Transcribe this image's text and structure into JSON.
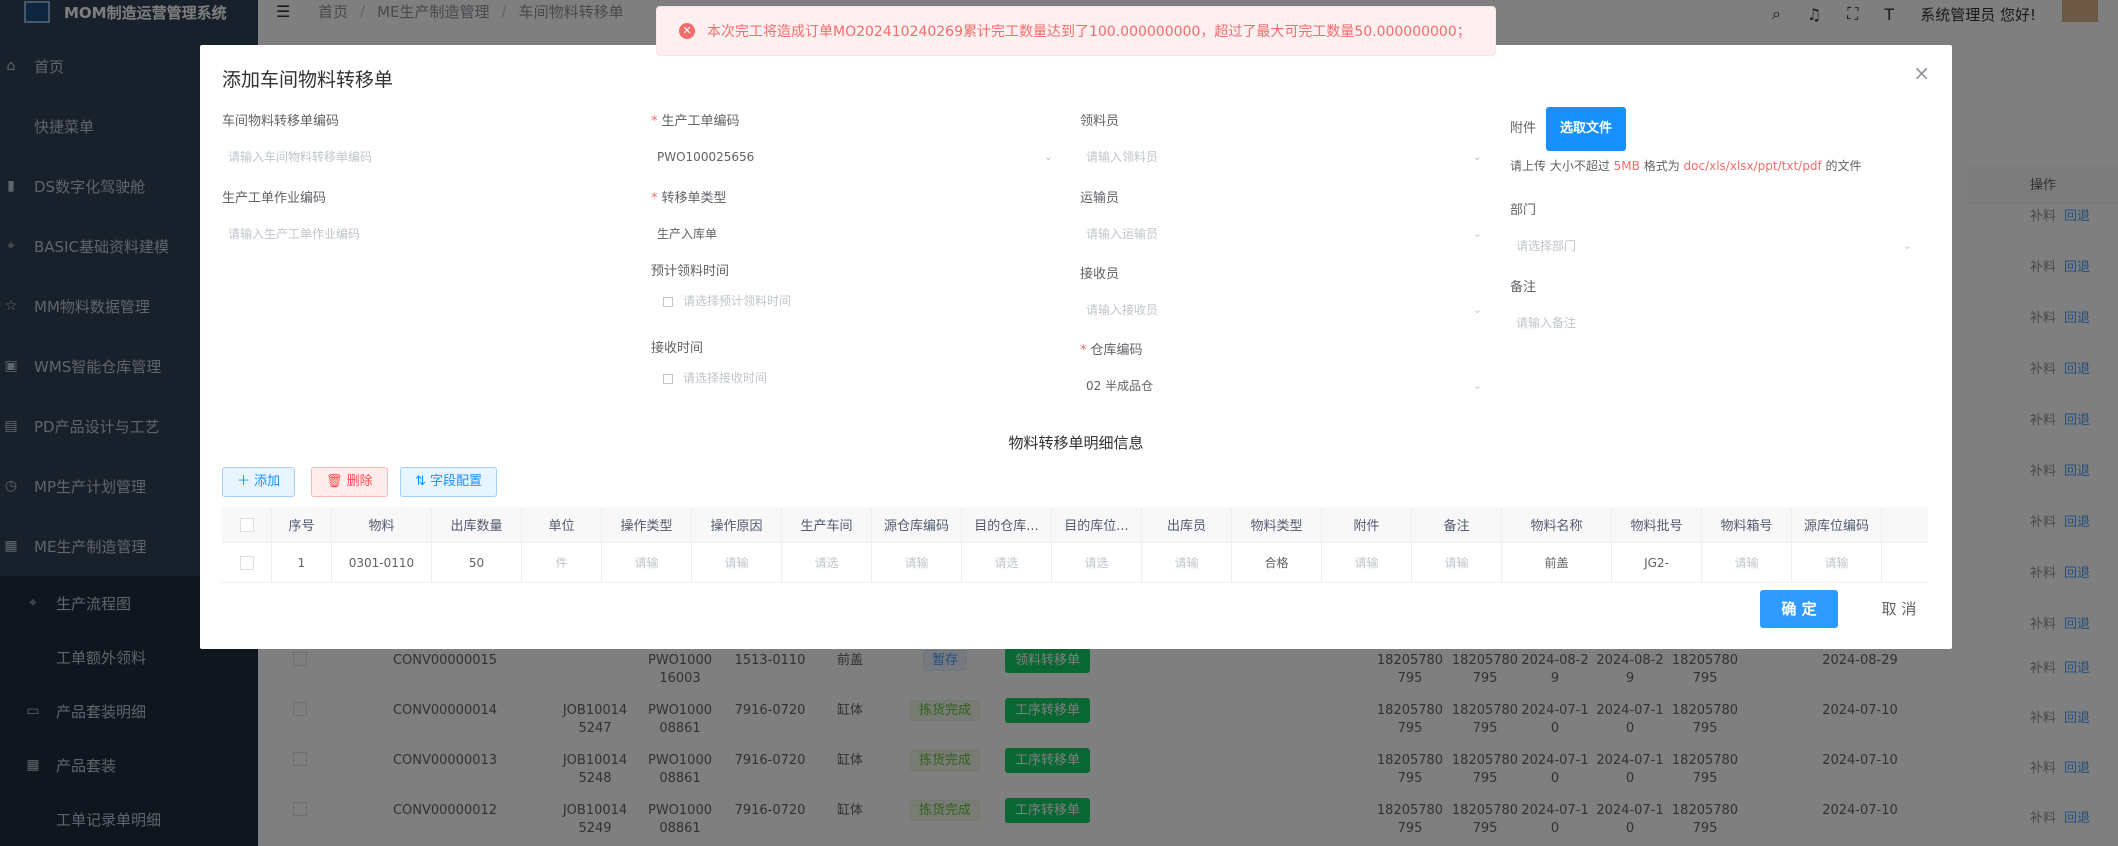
{
  "app": {
    "title": "MOM制造运营管理系统",
    "user": "系统管理员 您好!"
  },
  "breadcrumb": [
    "首页",
    "ME生产制造管理",
    "车间物料转移单"
  ],
  "sidebar": [
    {
      "icon": "home-icon",
      "label": "首页"
    },
    {
      "icon": "",
      "label": "快捷菜单"
    },
    {
      "icon": "bar-chart-icon",
      "label": "DS数字化驾驶舱"
    },
    {
      "icon": "hierarchy-icon",
      "label": "BASIC基础资料建模"
    },
    {
      "icon": "star-icon",
      "label": "MM物料数据管理"
    },
    {
      "icon": "box-icon",
      "label": "WMS智能仓库管理"
    },
    {
      "icon": "document-icon",
      "label": "PD产品设计与工艺"
    },
    {
      "icon": "clock-icon",
      "label": "MP生产计划管理"
    },
    {
      "icon": "factory-icon",
      "label": "ME生产制造管理"
    }
  ],
  "sidebar_sub": [
    {
      "icon": "hierarchy-icon",
      "label": "生产流程图"
    },
    {
      "icon": "",
      "label": "工单额外领料"
    },
    {
      "icon": "card-icon",
      "label": "产品套装明细"
    },
    {
      "icon": "grid-icon",
      "label": "产品套装"
    },
    {
      "icon": "",
      "label": "工单记录单明细"
    }
  ],
  "toast": "本次完工将造成订单MO202410240269累计完工数量达到了100.000000000，超过了最大可完工数量50.000000000；",
  "dialog": {
    "title": "添加车间物料转移单",
    "fields": {
      "transfer_code": {
        "label": "车间物料转移单编码",
        "placeholder": "请输入车间物料转移单编码"
      },
      "wo_code": {
        "label": "生产工单编码",
        "value": "PWO100025656"
      },
      "picker": {
        "label": "领料员",
        "placeholder": "请输入领料员"
      },
      "wo_op_code": {
        "label": "生产工单作业编码",
        "placeholder": "请输入生产工单作业编码"
      },
      "transfer_type": {
        "label": "转移单类型",
        "value": "生产入库单"
      },
      "transporter": {
        "label": "运输员",
        "placeholder": "请输入运输员"
      },
      "plan_time": {
        "label": "预计领料时间",
        "placeholder": "请选择预计领料时间"
      },
      "receiver": {
        "label": "接收员",
        "placeholder": "请输入接收员"
      },
      "receive_time": {
        "label": "接收时间",
        "placeholder": "请选择接收时间"
      },
      "warehouse": {
        "label": "仓库编码",
        "value": "02 半成品仓"
      },
      "attachment": {
        "label": "附件",
        "button": "选取文件",
        "hint_pre": "请上传 大小不超过 ",
        "hint_size": "5MB",
        "hint_mid": " 格式为 ",
        "hint_fmt": "doc/xls/xlsx/ppt/txt/pdf",
        "hint_post": " 的文件"
      },
      "dept": {
        "label": "部门",
        "placeholder": "请选择部门"
      },
      "remark": {
        "label": "备注",
        "placeholder": "请输入备注"
      }
    },
    "section_title": "物料转移单明细信息",
    "buttons": {
      "add": "添加",
      "delete": "删除",
      "fields": "字段配置",
      "ok": "确 定",
      "cancel": "取 消"
    },
    "columns": [
      "",
      "序号",
      "物料",
      "出库数量",
      "单位",
      "操作类型",
      "操作原因",
      "生产车间",
      "源仓库编码",
      "目的仓库...",
      "目的库位...",
      "出库员",
      "物料类型",
      "附件",
      "备注",
      "物料名称",
      "物料批号",
      "物料箱号",
      "源库位编码"
    ],
    "row": [
      "",
      "1",
      "0301-0110",
      "50",
      "件",
      "请输",
      "请输",
      "请选",
      "请输",
      "请选",
      "请选",
      "请输",
      "合格",
      "请输",
      "请输",
      "前盖",
      "JG2-",
      "请输",
      "请输"
    ]
  },
  "bg_header": {
    "op": "操作"
  },
  "bg_rows": [
    {
      "code": "CONV00000015",
      "job": "",
      "pwo": "PWO1000 16003",
      "mat": "1513-0110",
      "name": "前盖",
      "status": "暂存",
      "status_type": "blue",
      "action": "领料转移单",
      "n1": "18205780 795",
      "n2": "18205780 795",
      "d1": "2024-08-2 9",
      "d2": "2024-08-2 9",
      "n3": "18205780 795",
      "date": "2024-08-29",
      "op1": "补料",
      "op2": "回退"
    },
    {
      "code": "CONV00000014",
      "job": "JOB10014 5247",
      "pwo": "PWO1000 08861",
      "mat": "7916-0720",
      "name": "缸体",
      "status": "拣货完成",
      "status_type": "green",
      "action": "工序转移单",
      "n1": "18205780 795",
      "n2": "18205780 795",
      "d1": "2024-07-1 0",
      "d2": "2024-07-1 0",
      "n3": "18205780 795",
      "date": "2024-07-10",
      "op1": "补料",
      "op2": "回退"
    },
    {
      "code": "CONV00000013",
      "job": "JOB10014 5248",
      "pwo": "PWO1000 08861",
      "mat": "7916-0720",
      "name": "缸体",
      "status": "拣货完成",
      "status_type": "green",
      "action": "工序转移单",
      "n1": "18205780 795",
      "n2": "18205780 795",
      "d1": "2024-07-1 0",
      "d2": "2024-07-1 0",
      "n3": "18205780 795",
      "date": "2024-07-10",
      "op1": "补料",
      "op2": "回退"
    },
    {
      "code": "CONV00000012",
      "job": "JOB10014 5249",
      "pwo": "PWO1000 08861",
      "mat": "7916-0720",
      "name": "缸体",
      "status": "拣货完成",
      "status_type": "green",
      "action": "工序转移单",
      "n1": "18205780 795",
      "n2": "18205780 795",
      "d1": "2024-07-1 0",
      "d2": "2024-07-1 0",
      "n3": "18205780 795",
      "date": "2024-07-10",
      "op1": "补料",
      "op2": "回退"
    }
  ],
  "right_ops": {
    "op1": "补料",
    "op2": "回退"
  }
}
